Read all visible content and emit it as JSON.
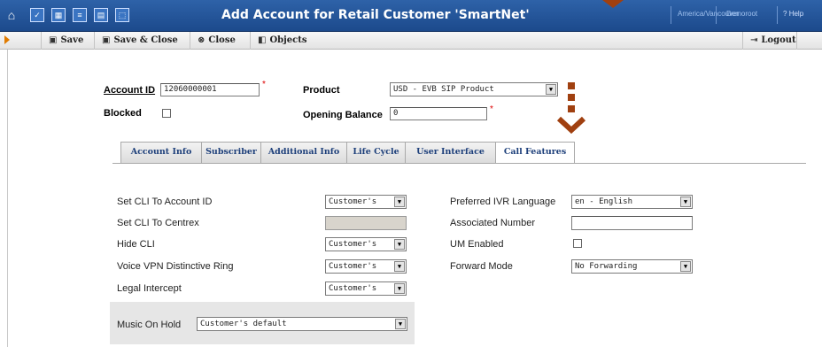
{
  "window": {
    "title": "Add Account for Retail Customer 'SmartNet'",
    "timezone": "America/Vancouver",
    "user": "Demoroot",
    "help": "Help"
  },
  "toolbar": {
    "save": "Save",
    "save_close": "Save & Close",
    "close": "Close",
    "objects": "Objects",
    "logout": "Logout"
  },
  "account": {
    "account_id_label": "Account ID",
    "account_id_value": "12060000001",
    "product_label": "Product",
    "product_value": "USD - EVB SIP Product",
    "blocked_label": "Blocked",
    "opening_balance_label": "Opening Balance",
    "opening_balance_value": "0",
    "required_mark": "*"
  },
  "tabs": [
    "Account Info",
    "Subscriber",
    "Additional Info",
    "Life Cycle",
    "User Interface",
    "Call Features"
  ],
  "call_features": {
    "left": [
      {
        "label": "Set CLI To Account ID",
        "value": "Customer's"
      },
      {
        "label": "Set CLI To Centrex",
        "value": ""
      },
      {
        "label": "Hide CLI",
        "value": "Customer's"
      },
      {
        "label": "Voice VPN Distinctive Ring",
        "value": "Customer's"
      },
      {
        "label": "Legal Intercept",
        "value": "Customer's"
      }
    ],
    "right": [
      {
        "label": "Preferred IVR Language",
        "value": "en - English"
      },
      {
        "label": "Associated Number",
        "value": ""
      },
      {
        "label": "UM Enabled",
        "value": ""
      },
      {
        "label": "Forward Mode",
        "value": "No Forwarding"
      }
    ],
    "moh_label": "Music On Hold",
    "moh_value": "Customer's default"
  },
  "colors": {
    "titlebar": "#1c4a8c",
    "accent_arrow": "#a04010",
    "tab_text": "#1d3f7a"
  }
}
